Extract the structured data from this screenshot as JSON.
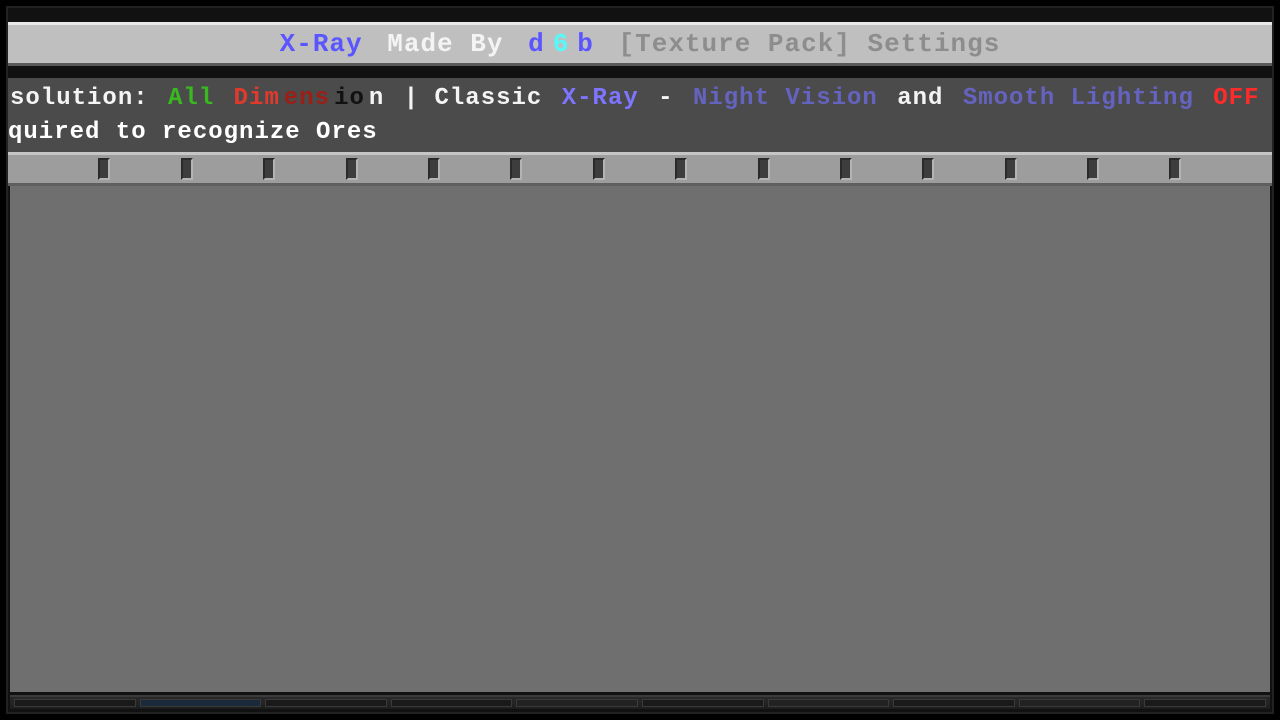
{
  "header": {
    "tokens": [
      {
        "text": "X-Ray",
        "cls": "c-blue"
      },
      {
        "text": " Made By ",
        "cls": "c-white"
      },
      {
        "text": "d",
        "cls": "c-blue"
      },
      {
        "text": "6",
        "cls": "c-cyan"
      },
      {
        "text": "b",
        "cls": "c-blue"
      },
      {
        "text": " [Texture Pack] Settings",
        "cls": "c-grey"
      }
    ]
  },
  "subtitle": {
    "line1": [
      {
        "text": "solution: ",
        "cls": "c-white"
      },
      {
        "text": "All ",
        "cls": "c-green"
      },
      {
        "text": "Dim",
        "cls": "c-red"
      },
      {
        "text": "ens",
        "cls": "c-dred"
      },
      {
        "text": "io",
        "cls": "c-black"
      },
      {
        "text": "n",
        "cls": "c-white"
      },
      {
        "text": " | Classic ",
        "cls": "c-white"
      },
      {
        "text": "X-Ray",
        "cls": "c-lav"
      },
      {
        "text": " - ",
        "cls": "c-white"
      },
      {
        "text": "Night Vision",
        "cls": "c-pblue"
      },
      {
        "text": " and ",
        "cls": "c-white"
      },
      {
        "text": "Smooth Lighting",
        "cls": "c-pblue"
      },
      {
        "text": " OFF ",
        "cls": "c-bright"
      }
    ],
    "line2": "quired to recognize Ores"
  },
  "slots": {
    "count": 14
  }
}
